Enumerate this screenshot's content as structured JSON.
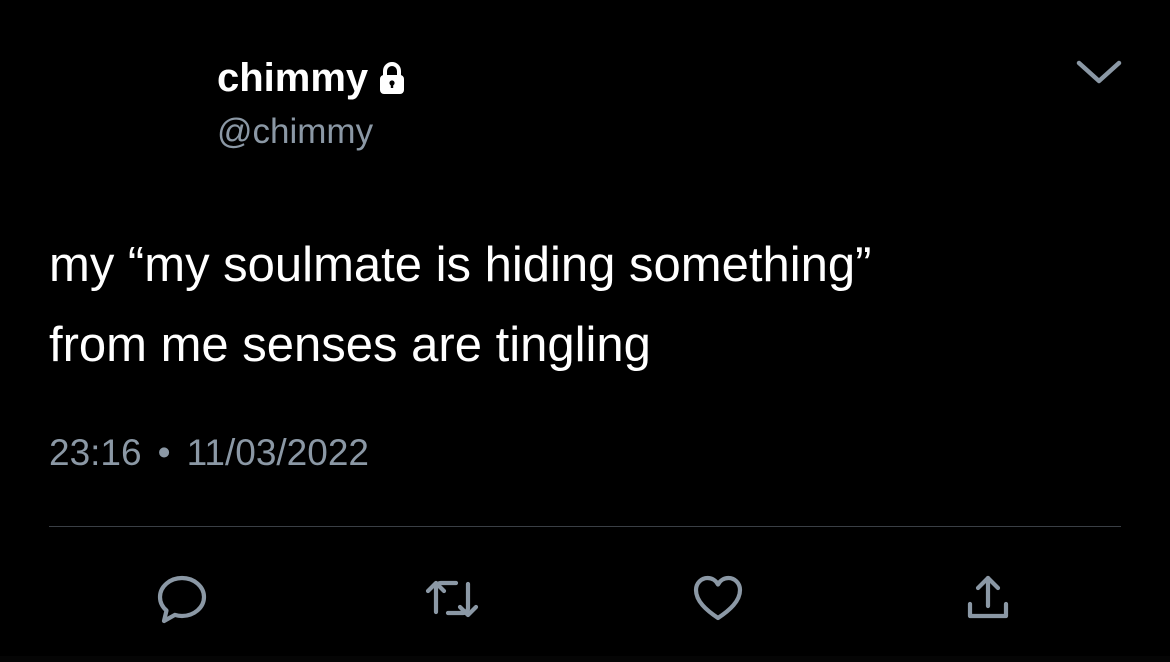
{
  "tweet": {
    "display_name": "chimmy",
    "handle": "@chimmy",
    "locked": true,
    "text_line_1": "my “my soulmate is hiding something”",
    "text_line_2": "from me senses are tingling",
    "time": "23:16",
    "separator": "•",
    "date": "11/03/2022"
  },
  "icons": {
    "lock": "lock-icon",
    "menu": "chevron-down-icon",
    "reply": "reply-icon",
    "retweet": "retweet-icon",
    "like": "heart-icon",
    "share": "share-icon"
  },
  "colors": {
    "background": "#000000",
    "primary_text": "#ffffff",
    "secondary_text": "#8b98a5",
    "divider": "#3a3f45"
  }
}
